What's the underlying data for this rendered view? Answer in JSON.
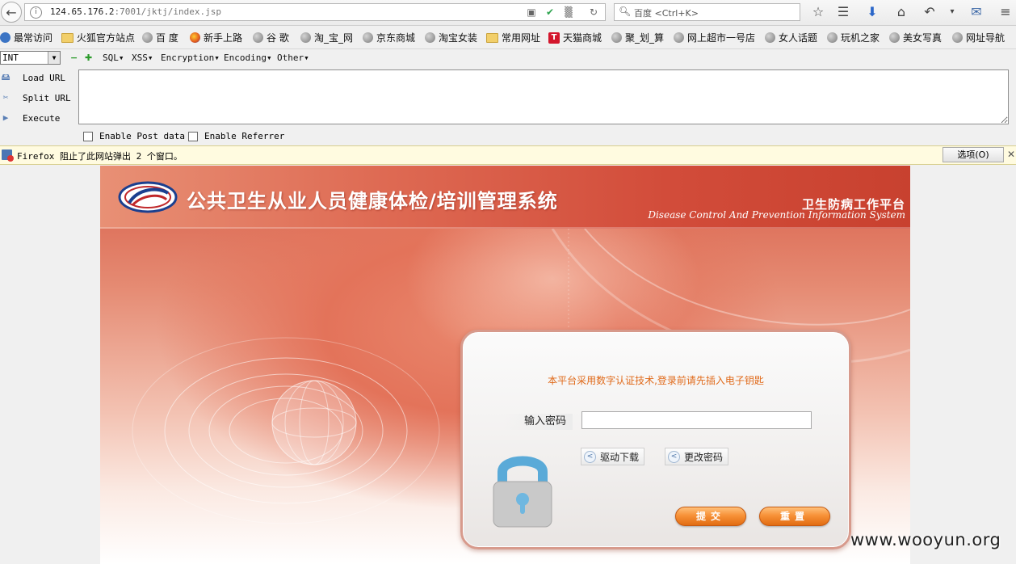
{
  "browser": {
    "url_host": "124.65.176.2",
    "url_rest": ":7001/jktj/index.jsp",
    "search_placeholder": "百度 <Ctrl+K>"
  },
  "bookmarks": [
    {
      "label": "最常访问",
      "icon": "most-visited-icon"
    },
    {
      "label": "火狐官方站点",
      "icon": "folder-icon"
    },
    {
      "label": "百 度",
      "icon": "globe-icon"
    },
    {
      "label": "新手上路",
      "icon": "firefox-icon"
    },
    {
      "label": "谷 歌",
      "icon": "globe-icon"
    },
    {
      "label": "淘_宝_网",
      "icon": "globe-icon"
    },
    {
      "label": "京东商城",
      "icon": "globe-icon"
    },
    {
      "label": "淘宝女装",
      "icon": "globe-icon"
    },
    {
      "label": "常用网址",
      "icon": "folder-icon"
    },
    {
      "label": "天猫商城",
      "icon": "tmall-icon"
    },
    {
      "label": "聚_划_算",
      "icon": "globe-icon"
    },
    {
      "label": "网上超市一号店",
      "icon": "globe-icon"
    },
    {
      "label": "女人话题",
      "icon": "globe-icon"
    },
    {
      "label": "玩机之家",
      "icon": "globe-icon"
    },
    {
      "label": "美女写真",
      "icon": "globe-icon"
    },
    {
      "label": "网址导航",
      "icon": "globe-icon"
    }
  ],
  "hackbar": {
    "select_value": "INT",
    "menus": [
      "SQL▾",
      "XSS▾",
      "Encryption▾",
      "Encoding▾",
      "Other▾"
    ],
    "load_url": "Load URL",
    "split_url": "Split URL",
    "execute": "Execute",
    "enable_post": "Enable Post data",
    "enable_referrer": "Enable Referrer",
    "textarea_value": ""
  },
  "notification": {
    "text": "Firefox 阻止了此网站弹出 2 个窗口。",
    "options_button": "选项(O)"
  },
  "page": {
    "title": "公共卫生从业人员健康体检/培训管理系统",
    "platform_cn": "卫生防病工作平台",
    "platform_en": "Disease Control And Prevention Information System",
    "notice": "本平台采用数字认证技术,登录前请先插入电子钥匙",
    "password_label": "输入密码",
    "password_value": "",
    "driver_download": "驱动下载",
    "change_password": "更改密码",
    "submit": "提交",
    "reset": "重置"
  },
  "watermark": "www.wooyun.org",
  "colors": {
    "accent_orange": "#f28a2c",
    "notice_orange": "#e06a1a",
    "header_red": "#d24c3a"
  }
}
